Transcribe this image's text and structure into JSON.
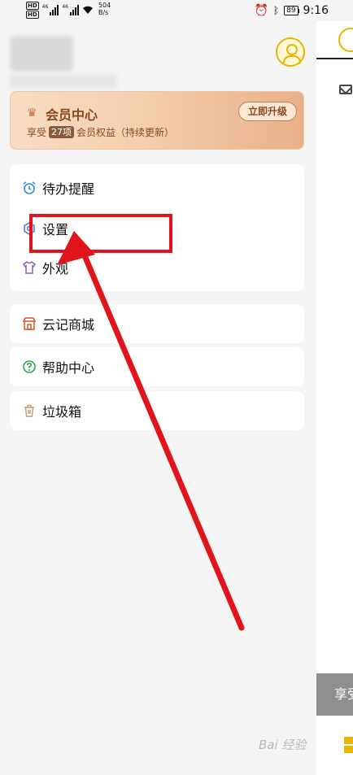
{
  "status_bar": {
    "network_left": "HD",
    "network_speed": "504",
    "network_speed_unit": "B/s",
    "signal_label": "46",
    "battery": "89",
    "time": "9:16"
  },
  "vip": {
    "title": "会员中心",
    "sub_prefix": "享受",
    "count_badge": "27项",
    "sub_suffix": "会员权益（持续更新）",
    "upgrade_label": "立即升级"
  },
  "menu_group_1": [
    {
      "label": "待办提醒",
      "icon": "alarm-clock-icon"
    },
    {
      "label": "设置",
      "icon": "settings-icon"
    },
    {
      "label": "外观",
      "icon": "shirt-icon"
    }
  ],
  "menu_group_2": [
    {
      "label": "云记商城",
      "icon": "store-icon"
    },
    {
      "label": "帮助中心",
      "icon": "help-icon"
    },
    {
      "label": "垃圾箱",
      "icon": "trash-icon"
    }
  ],
  "right_panel": {
    "banner_text": "享受"
  },
  "watermark": "Bai 经验",
  "colors": {
    "accent": "#e8b400",
    "highlight": "#e0141a",
    "vip_text": "#8a4a20"
  }
}
